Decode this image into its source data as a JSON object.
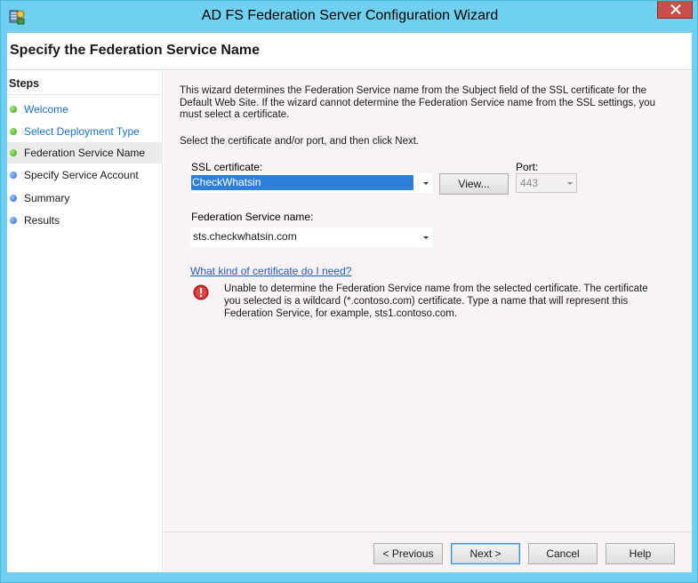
{
  "window": {
    "title": "AD FS Federation Server Configuration Wizard",
    "app_icon": "adfs-server-icon",
    "close_icon": "close-icon"
  },
  "header": {
    "title": "Specify the Federation Service Name"
  },
  "sidebar": {
    "heading": "Steps",
    "items": [
      {
        "label": "Welcome",
        "state": "done"
      },
      {
        "label": "Select Deployment Type",
        "state": "done"
      },
      {
        "label": "Federation Service Name",
        "state": "current"
      },
      {
        "label": "Specify Service Account",
        "state": "todo"
      },
      {
        "label": "Summary",
        "state": "todo"
      },
      {
        "label": "Results",
        "state": "todo"
      }
    ]
  },
  "main": {
    "intro": "This wizard determines the Federation Service name from the Subject field of the SSL certificate for the Default Web Site.  If the wizard cannot determine the Federation Service name from the SSL settings, you must select a certificate.",
    "instruction": "Select the certificate and/or port, and then click Next.",
    "ssl_label": "SSL certificate:",
    "ssl_value": "CheckWhatsin",
    "view_button": "View...",
    "port_label": "Port:",
    "port_value": "443",
    "fsn_label": "Federation Service name:",
    "fsn_value": "sts.checkwhatsin.com",
    "help_link": "What kind of certificate do I need?",
    "error_icon": "error-icon",
    "error_message": "Unable to determine the Federation Service name from the selected certificate. The certificate you selected is a wildcard (*.contoso.com) certificate. Type a name that will represent this Federation Service, for example, sts1.contoso.com."
  },
  "footer": {
    "previous": "< Previous",
    "next": "Next >",
    "cancel": "Cancel",
    "help": "Help"
  },
  "colors": {
    "window_frame": "#6fd0ef",
    "close_button": "#c7504a",
    "selection": "#2f7ed8",
    "link": "#1a5fc8",
    "step_done": "#2ea11a",
    "step_todo": "#1c5fd6",
    "error": "#d32f2f"
  }
}
